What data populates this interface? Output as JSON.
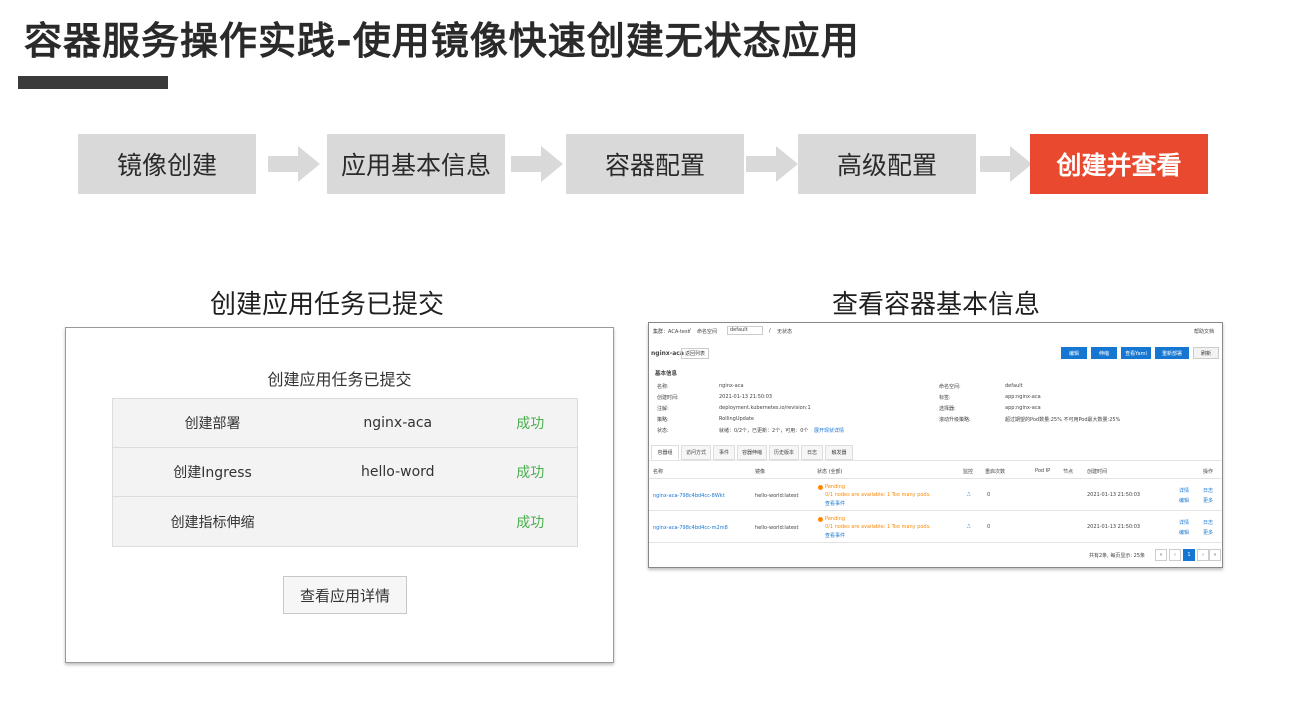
{
  "title": "容器服务操作实践-使用镜像快速创建无状态应用",
  "steps": [
    "镜像创建",
    "应用基本信息",
    "容器配置",
    "高级配置",
    "创建并查看"
  ],
  "left_section_title": "创建应用任务已提交",
  "right_section_title": "查看容器基本信息",
  "task_panel": {
    "title": "创建应用任务已提交",
    "rows": [
      {
        "name": "创建部署",
        "target": "nginx-aca",
        "status": "成功"
      },
      {
        "name": "创建Ingress",
        "target": "hello-word",
        "status": "成功"
      },
      {
        "name": "创建指标伸缩",
        "target": "",
        "status": "成功"
      }
    ],
    "detail_button": "查看应用详情",
    "status_color": "#4caf50"
  },
  "detail_panel": {
    "breadcrumb": [
      "集群：ACA-test",
      "/",
      "命名空间",
      "default",
      "/",
      "无状态"
    ],
    "help_link": "帮助文档",
    "app_name": "nginx-aca",
    "back_link": "返回列表",
    "action_buttons": [
      "编辑",
      "伸缩",
      "查看Yaml",
      "重新部署",
      "刷新"
    ],
    "basic_info_title": "基本信息",
    "info_left": [
      {
        "label": "名称:",
        "value": "nginx-aca"
      },
      {
        "label": "创建时间:",
        "value": "2021-01-13 21:50:03"
      },
      {
        "label": "注解:",
        "value": "deployment.kubernetes.io/revision:1"
      },
      {
        "label": "策略:",
        "value": "RollingUpdate"
      },
      {
        "label": "状态:",
        "value": "就绪：0/2个，已更新：2个，可用：0个",
        "link": "展开现状详情"
      }
    ],
    "info_right": [
      {
        "label": "命名空间:",
        "value": "default"
      },
      {
        "label": "标签:",
        "value": "app:nginx-aca"
      },
      {
        "label": "选择器:",
        "value": "app:nginx-aca"
      },
      {
        "label": "滚动升级策略:",
        "value": "超过期望的Pod数量:25%  不可用Pod最大数量:25%"
      }
    ],
    "tabs": [
      "容器组",
      "访问方式",
      "事件",
      "容器伸缩",
      "历史版本",
      "日志",
      "触发器"
    ],
    "table_headers": [
      "名称",
      "镜像",
      "状态 (全部)",
      "监控",
      "重启次数",
      "Pod IP",
      "节点",
      "创建时间",
      "操作"
    ],
    "rows": [
      {
        "name": "nginx-aca-798c4bd4cc-8Wkt",
        "image": "hello-world:latest",
        "status": "Pending",
        "message": "0/1 nodes are available: 1 Too many pods.",
        "event_link": "查看事件",
        "restarts": "0",
        "created": "2021-01-13 21:50:03",
        "ops": [
          "详情",
          "日志",
          "编辑",
          "更多"
        ]
      },
      {
        "name": "nginx-aca-798c4bd4cc-m2m8",
        "image": "hello-world:latest",
        "status": "Pending",
        "message": "0/1 nodes are available: 1 Too many pods.",
        "event_link": "查看事件",
        "restarts": "0",
        "created": "2021-01-13 21:50:03",
        "ops": [
          "详情",
          "日志",
          "编辑",
          "更多"
        ]
      }
    ],
    "pagination_text": "共有2条, 每页显示: 25条",
    "current_page": "1",
    "accent_color": "#1677d2",
    "warning_color": "#ff8800"
  },
  "colors": {
    "active_step": "#e8492f",
    "step": "#d9d9d9",
    "title_bar": "#3a3a3a"
  }
}
